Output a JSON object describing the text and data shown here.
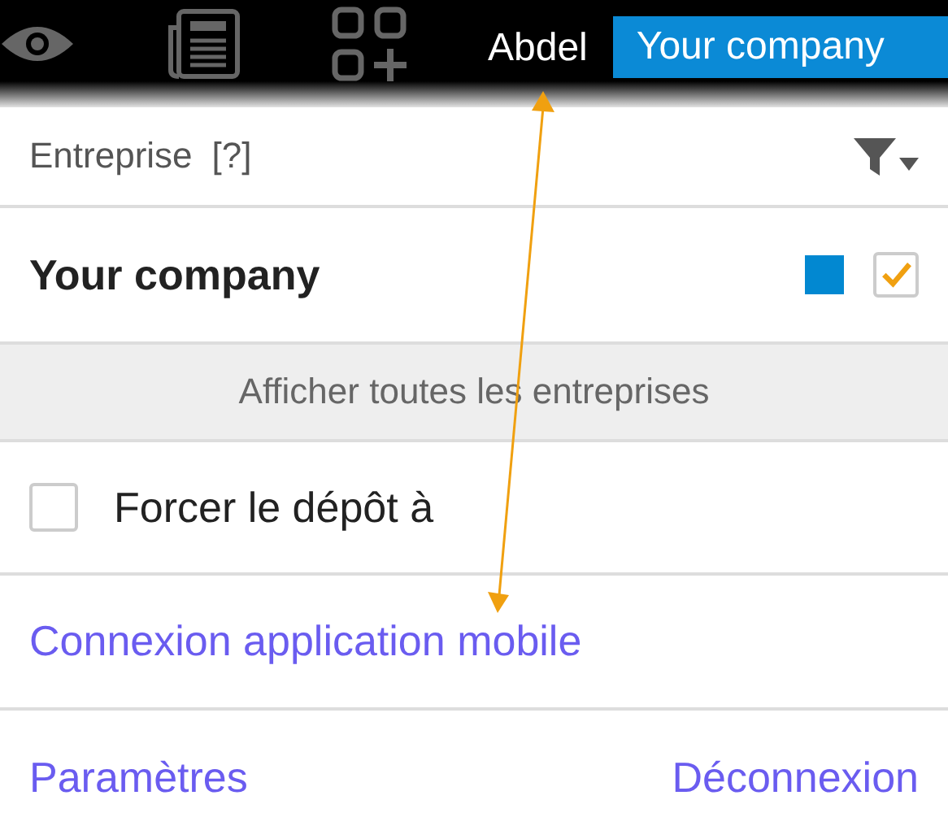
{
  "top_bar": {
    "user": "Abdel",
    "company": "Your company"
  },
  "header": {
    "label": "Entreprise",
    "help": "[?]"
  },
  "company": {
    "name": "Your company",
    "color": "#0288d1",
    "checked": true
  },
  "show_all": "Afficher toutes les entreprises",
  "force_deposit": {
    "label": "Forcer le dépôt à",
    "checked": false
  },
  "mobile_link": "Connexion application mobile",
  "footer": {
    "settings": "Paramètres",
    "logout": "Déconnexion"
  }
}
